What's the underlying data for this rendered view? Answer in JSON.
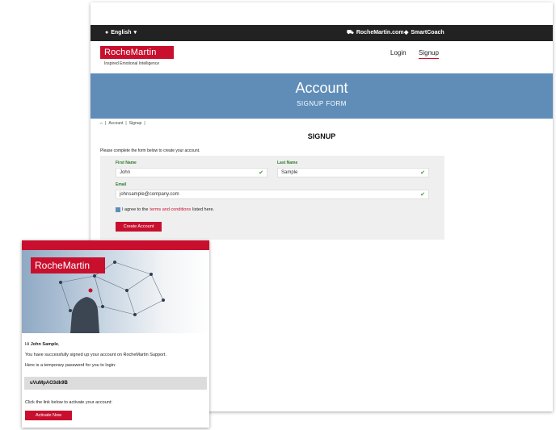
{
  "topbar": {
    "language": "English",
    "site_link": "RocheMartin.com",
    "smartcoach_link": "SmartCoach"
  },
  "brand": {
    "logo_text": "RocheMartin",
    "tagline": "Inspired Emotional Intelligence",
    "primary_color": "#c8102e",
    "hero_color": "#5f8db8"
  },
  "nav": {
    "login": "Login",
    "signup": "Signup"
  },
  "hero": {
    "title": "Account",
    "subtitle": "SIGNUP FORM"
  },
  "breadcrumb": {
    "home_icon": "home-icon",
    "items": [
      "Account",
      "Signup"
    ]
  },
  "form": {
    "heading": "SIGNUP",
    "intro": "Please complete the form below to create your account.",
    "first_name_label": "First Name",
    "first_name_value": "John",
    "last_name_label": "Last Name",
    "last_name_value": "Sample",
    "email_label": "Email",
    "email_value": "johnsample@company.com",
    "agree_prefix": "I agree to the",
    "agree_link": "terms and conditions",
    "agree_suffix": "listed here.",
    "submit_label": "Create Account"
  },
  "email": {
    "logo_text": "RocheMartin",
    "greeting_prefix": "Hi",
    "greeting_name": "John Sample",
    "line1": "You have successfully signed up your account on RocheMartin Support.",
    "line2": "Here is a temporary password for you to login:",
    "password": "uVuMpAO3dk9B",
    "activate_text": "Click the link below to activate your account:",
    "activate_label": "Activate Now"
  }
}
